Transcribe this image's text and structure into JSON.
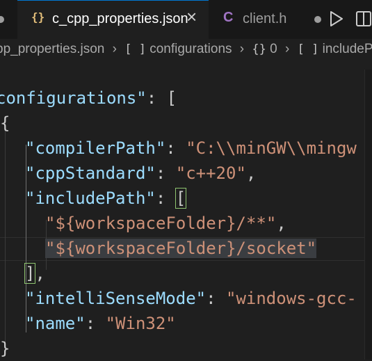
{
  "tabs": [
    {
      "icon": "{}",
      "label": "c_cpp_properties.json",
      "active": true
    },
    {
      "icon": "C",
      "label": "client.h",
      "active": false
    }
  ],
  "breadcrumb": {
    "file": "pp_properties.json",
    "seg1_icon": "[ ]",
    "seg1": "configurations",
    "seg2_icon": "{}",
    "seg2": "0",
    "seg3_icon": "[ ]",
    "seg3": "includePat"
  },
  "code": {
    "l1_key": "configurations\"",
    "l1_rest": ": [",
    "l2": "{",
    "l3_key": "\"compilerPath\"",
    "l3_colon": ": ",
    "l3_val": "\"C:\\\\minGW\\\\mingw",
    "l4_key": "\"cppStandard\"",
    "l4_colon": ": ",
    "l4_val": "\"c++20\"",
    "l4_comma": ",",
    "l5_key": "\"includePath\"",
    "l5_colon": ": ",
    "l5_bracket": "[",
    "l6_val": "\"${workspaceFolder}/**\"",
    "l6_comma": ",",
    "l7_val": "\"${workspaceFolder}/socket\"",
    "l8_bracket": "]",
    "l8_comma": ",",
    "l9_key": "\"intelliSenseMode\"",
    "l9_colon": ": ",
    "l9_val": "\"windows-gcc-",
    "l10_key": "\"name\"",
    "l10_colon": ": ",
    "l10_val": "\"Win32\"",
    "l11": "}"
  },
  "colors": {
    "key": "#9cdcfe",
    "string": "#ce9178",
    "bracket_match": "#8fc470",
    "json_icon": "#e5c07b",
    "c_icon": "#a074c4"
  }
}
